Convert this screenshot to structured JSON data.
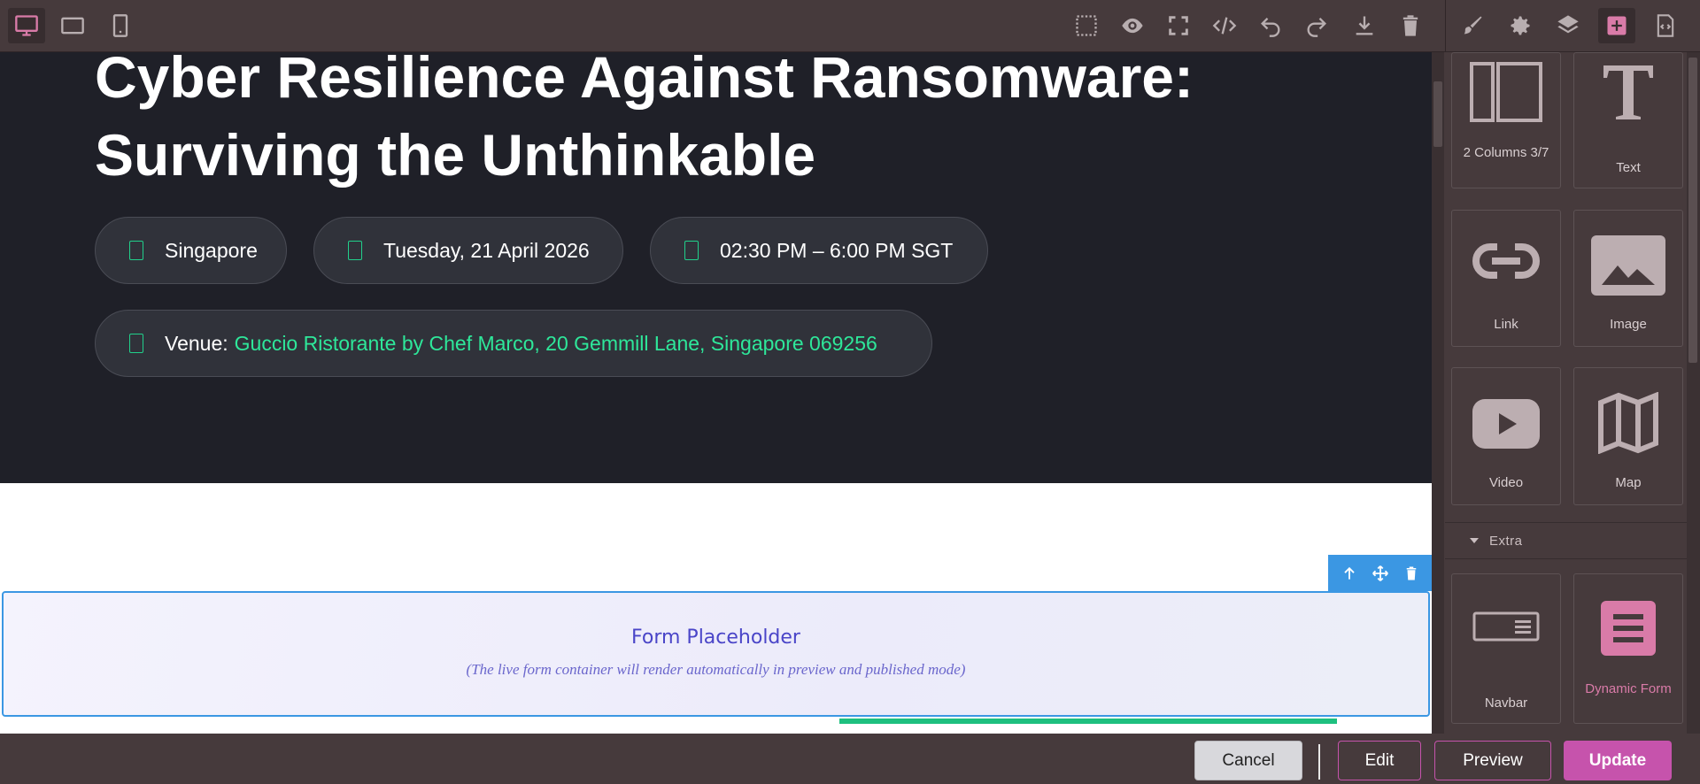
{
  "toolbar": {
    "devices": [
      "desktop-icon",
      "tablet-icon",
      "mobile-icon"
    ],
    "actions": [
      "select-outline-icon",
      "eye-icon",
      "fullscreen-icon",
      "code-icon",
      "undo-icon",
      "redo-icon",
      "download-icon",
      "trash-icon"
    ],
    "panels": [
      "brush-icon",
      "gear-icon",
      "layers-icon",
      "add-block-icon",
      "code-file-icon"
    ]
  },
  "hero": {
    "title": "Cyber Resilience Against Ransomware: Surviving the Unthinkable",
    "location": "Singapore",
    "date": "Tuesday, 21 April 2026",
    "time": "02:30 PM – 6:00 PM SGT",
    "venue_label": "Venue:",
    "venue_value": "Guccio Ristorante by Chef Marco, 20 Gemmill Lane, Singapore 069256"
  },
  "form_placeholder": {
    "title": "Form Placeholder",
    "subtitle": "(The live form container will render automatically in preview and published mode)"
  },
  "blocks": {
    "two_columns": "2 Columns 3/7",
    "text": "Text",
    "link": "Link",
    "image": "Image",
    "video": "Video",
    "map": "Map",
    "category_extra": "Extra",
    "navbar": "Navbar",
    "dynamic_form": "Dynamic Form"
  },
  "footer": {
    "cancel": "Cancel",
    "edit": "Edit",
    "preview": "Preview",
    "update": "Update"
  },
  "colors": {
    "accent_pink": "#c653ac",
    "accent_green": "#2ee79a",
    "selection_blue": "#3b97e3",
    "hero_bg": "#1f2028"
  }
}
